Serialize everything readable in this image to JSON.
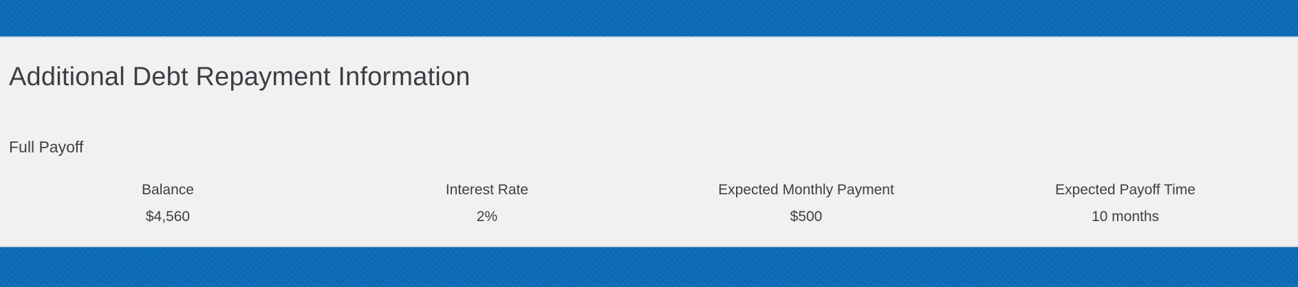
{
  "section": {
    "title": "Additional Debt Repayment Information",
    "subtitle": "Full Payoff"
  },
  "stats": [
    {
      "label": "Balance",
      "value": "$4,560"
    },
    {
      "label": "Interest Rate",
      "value": "2%"
    },
    {
      "label": "Expected Monthly Payment",
      "value": "$500"
    },
    {
      "label": "Expected Payoff Time",
      "value": "10 months"
    }
  ],
  "colors": {
    "band": "#0a6bb7",
    "panel": "#f1f1f1",
    "text": "#3b3f44"
  }
}
